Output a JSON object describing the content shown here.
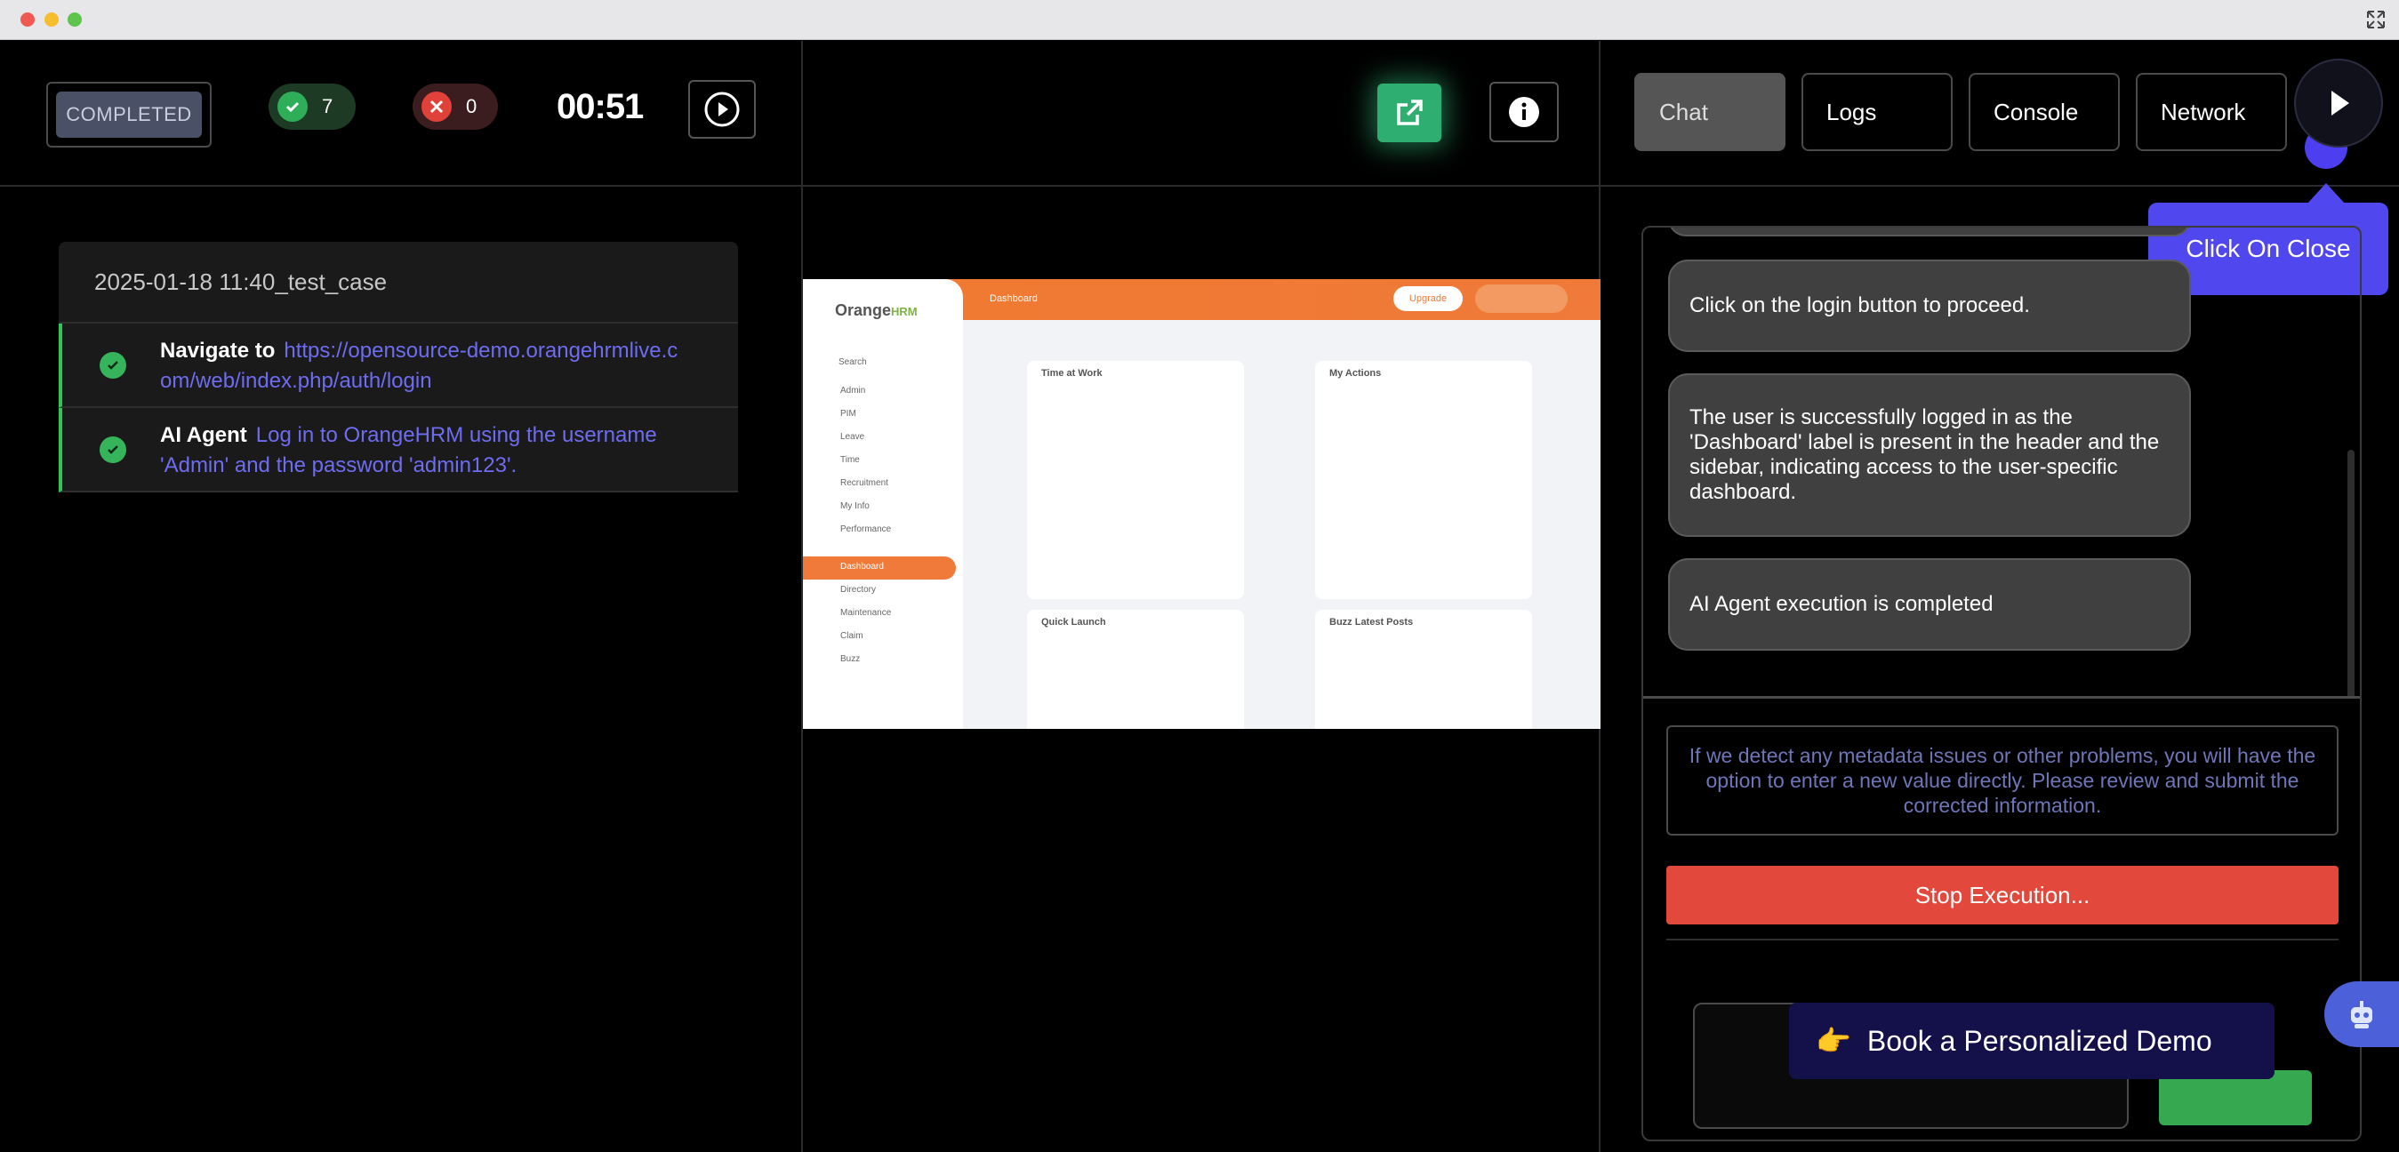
{
  "left": {
    "status": "COMPLETED",
    "passed_count": "7",
    "failed_count": "0",
    "timer": "00:51",
    "case_title": "2025-01-18 11:40_test_case",
    "steps": [
      {
        "label": "Navigate to",
        "text": "https://opensource-demo.orangehrmlive.com/web/index.php/auth/login"
      },
      {
        "label": "AI Agent",
        "text": "Log in to OrangeHRM using the username 'Admin' and the password 'admin123'."
      }
    ]
  },
  "preview": {
    "logo": "Orange",
    "logo_sub": "HRM",
    "header_title": "Dashboard",
    "upgrade": "Upgrade",
    "search": "Search",
    "menu": [
      "Admin",
      "PIM",
      "Leave",
      "Time",
      "Recruitment",
      "My Info",
      "Performance",
      "Dashboard",
      "Directory",
      "Maintenance",
      "Claim",
      "Buzz"
    ],
    "cards": {
      "time": "Time at Work",
      "actions": "My Actions",
      "quick": "Quick Launch",
      "buzz": "Buzz Latest Posts"
    }
  },
  "right": {
    "tabs": [
      "Chat",
      "Logs",
      "Console",
      "Network"
    ],
    "tooltip": "Click On Close",
    "messages": [
      "Click on the login button to proceed.",
      "The user is successfully logged in as the 'Dashboard' label is present in the header and the sidebar, indicating access to the user-specific dashboard.",
      "AI Agent execution is completed"
    ],
    "info_note": "If we detect any metadata issues or other problems, you will have the option to enter a new value directly. Please review and submit the corrected information.",
    "stop_label": "Stop Execution..."
  },
  "banner": {
    "text": "Book a Personalized Demo"
  },
  "colors": {
    "accent": "#5147ef",
    "success": "#2fae5a",
    "danger": "#e2483b",
    "orange": "#ef7a39"
  }
}
